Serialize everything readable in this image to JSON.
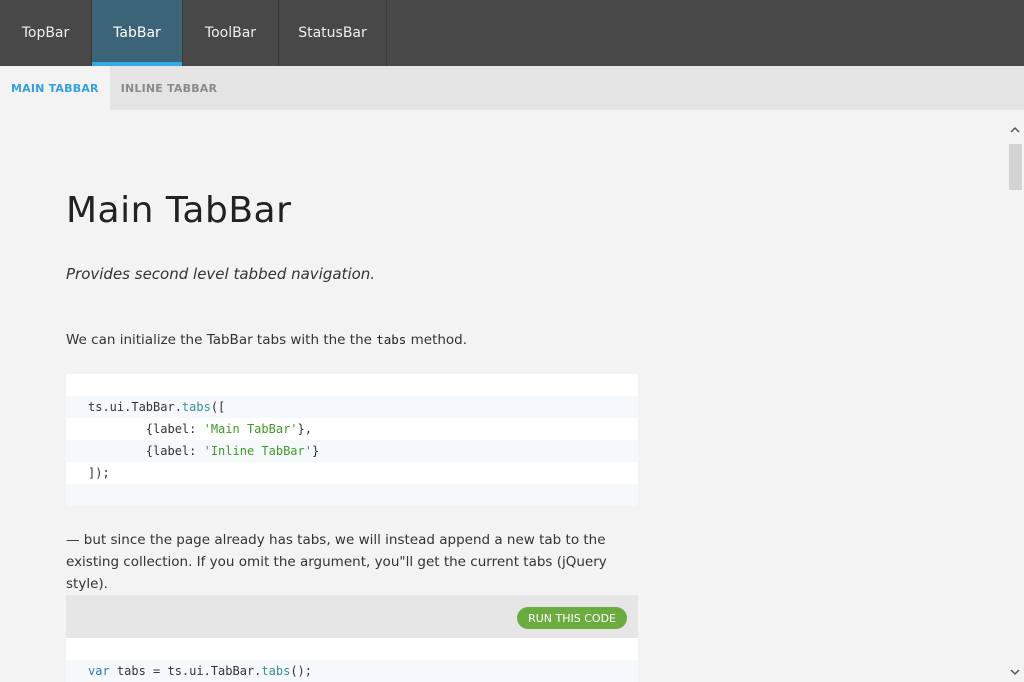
{
  "topbar": {
    "tabs": [
      {
        "label": "TopBar"
      },
      {
        "label": "TabBar"
      },
      {
        "label": "ToolBar"
      },
      {
        "label": "StatusBar"
      }
    ]
  },
  "subbar": {
    "tabs": [
      {
        "label": "MAIN TABBAR"
      },
      {
        "label": "INLINE TABBAR"
      }
    ]
  },
  "main": {
    "title": "Main TabBar",
    "lead": "Provides second level tabbed navigation.",
    "para1_pre": "We can initialize the TabBar tabs with the the ",
    "para1_code": "tabs",
    "para1_post": " method.",
    "code1": {
      "l1_obj": "ts.ui.TabBar.",
      "l1_fn": "tabs",
      "l1_end": "([",
      "l2_pre": "        {label: ",
      "l2_str": "'Main TabBar'",
      "l2_end": "},",
      "l3_pre": "        {label: ",
      "l3_str": "'Inline TabBar'",
      "l3_end": "}",
      "l4": "]);"
    },
    "para2": "— but since the page already has tabs, we will instead append a new tab to the existing collection. If you omit the argument, you\"ll get the current tabs (jQuery style).",
    "run_button": "RUN THIS CODE",
    "code2": {
      "kw": "var",
      "mid": " tabs = ts.ui.TabBar.",
      "fn": "tabs",
      "end": "();"
    }
  },
  "colors": {
    "topbar_bg": "#484848",
    "active_tab_bg": "#3c6478",
    "accent_blue": "#35a9e6",
    "run_button_green": "#6aac3f"
  }
}
